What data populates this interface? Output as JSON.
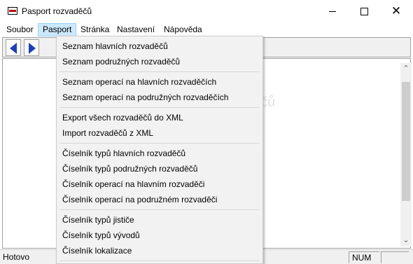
{
  "window": {
    "title": "Pasport rozvaděčů",
    "icon": "app-window-icon"
  },
  "menubar": {
    "items": [
      "Soubor",
      "Pasport",
      "Stránka",
      "Nastavení",
      "Nápověda"
    ],
    "active_index": 1
  },
  "toolbar": {
    "buttons": [
      "back-arrow-icon",
      "forward-arrow-icon"
    ]
  },
  "content": {
    "ghost_text": "čů"
  },
  "dropdown": {
    "groups": [
      [
        "Seznam hlavních rozvaděčů",
        "Seznam podružných rozvaděčů"
      ],
      [
        "Seznam operací na hlavních rozvaděčích",
        "Seznam operací na podružných rozvaděčích"
      ],
      [
        "Export všech rozvaděčů do XML",
        "Import rozvaděčů z XML"
      ],
      [
        "Číselník typů hlavních rozvaděčů",
        "Číselník typů podružných rozvaděčů",
        "Číselník operací na hlavním rozvaděči",
        "Číselník operací na podružném rozvaděči"
      ],
      [
        "Číselník typů jističe",
        "Číselník typů vývodů",
        "Číselník lokalizace"
      ]
    ]
  },
  "statusbar": {
    "text": "Hotovo",
    "num": "NUM"
  }
}
